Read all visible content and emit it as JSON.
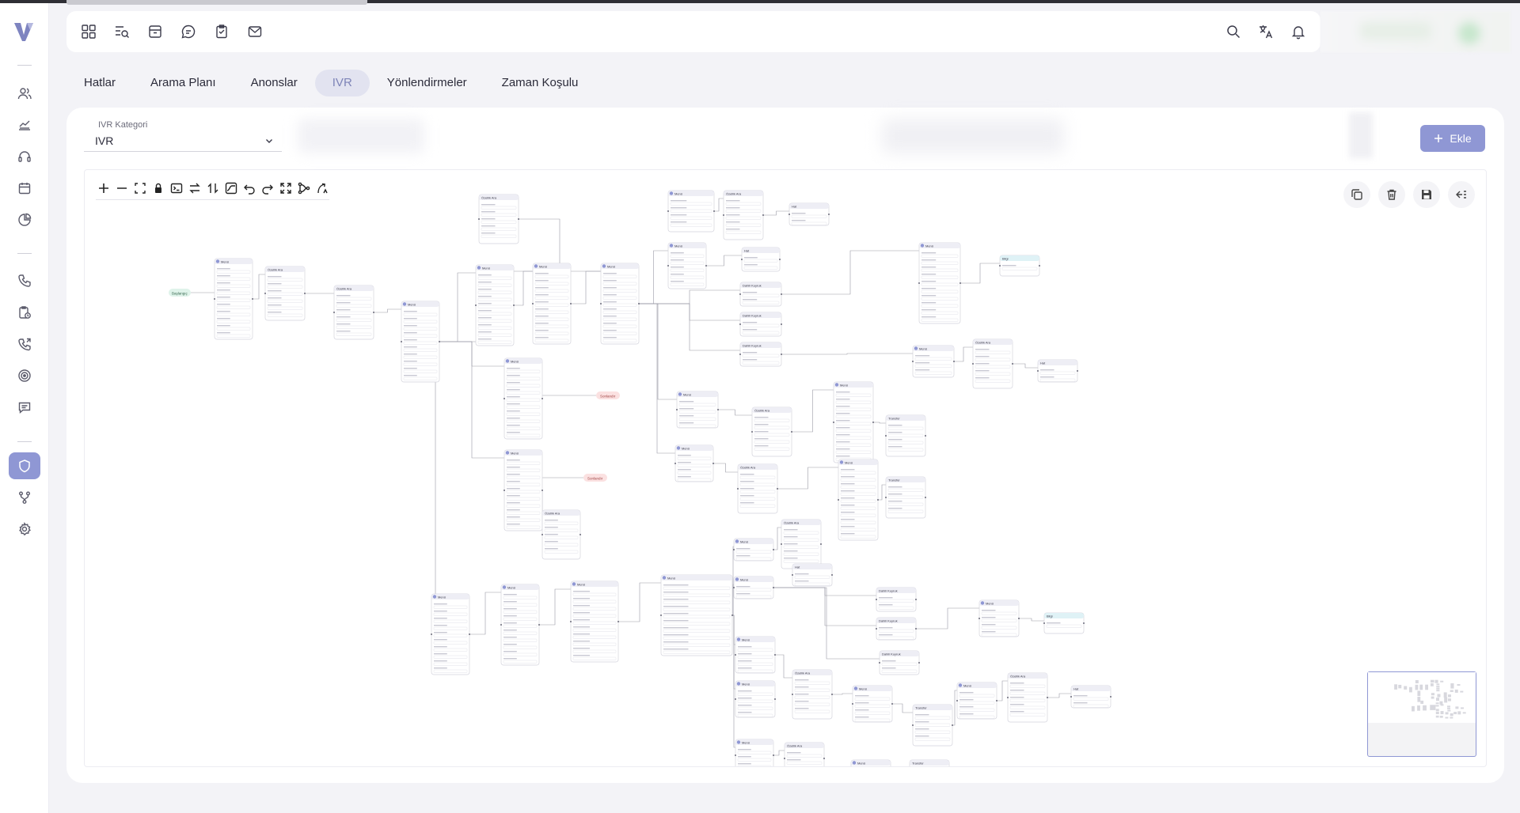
{
  "header": {
    "icons": [
      "dashboard-icon",
      "search-list-icon",
      "archive-icon",
      "chat-icon",
      "clipboard-icon",
      "mail-icon"
    ],
    "right_icons": [
      "search-icon",
      "translate-icon",
      "bell-icon"
    ]
  },
  "sidebar": {
    "items": [
      "users-icon",
      "chart-icon",
      "headset-icon",
      "calendar-icon",
      "pie-chart-icon",
      "phone-icon",
      "clipboard-clock-icon",
      "phone-forward-icon",
      "target-icon",
      "message-icon",
      "shield-icon",
      "branch-icon",
      "settings-icon"
    ],
    "active": "shield-icon"
  },
  "tabs": [
    {
      "label": "Hatlar"
    },
    {
      "label": "Arama Planı"
    },
    {
      "label": "Anonslar"
    },
    {
      "label": "IVR",
      "active": true
    },
    {
      "label": "Yönlendirmeler"
    },
    {
      "label": "Zaman Koşulu"
    }
  ],
  "filters": {
    "category_label": "IVR Kategori",
    "category_value": "IVR"
  },
  "actions": {
    "add_label": "Ekle"
  },
  "flow": {
    "start_label": "Başlangıç",
    "end_labels": [
      "Sonlandır",
      "Sonlandır"
    ],
    "node_titles": [
      "Menü",
      "Özellik Ara",
      "Dahili Kuyruk",
      "Transfer",
      "Hat",
      "Bilgi",
      "Zaman Koşulu"
    ]
  },
  "colors": {
    "accent": "#8f97d4",
    "start": "#dff3ea",
    "end": "#fbe1e1",
    "info": "#dff2f6"
  }
}
